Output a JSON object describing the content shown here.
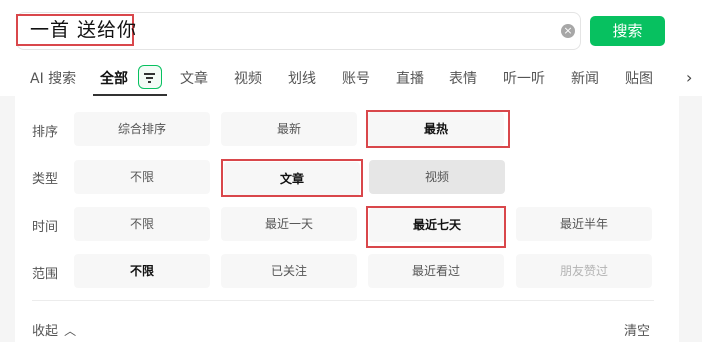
{
  "search": {
    "query": "一首 送给你",
    "clear_icon": "close-circle-icon",
    "button_label": "搜索",
    "button_color": "#07c160"
  },
  "tabs": [
    {
      "label": "AI 搜索"
    },
    {
      "label": "全部",
      "active": true
    },
    {
      "label": "文章"
    },
    {
      "label": "视频"
    },
    {
      "label": "划线"
    },
    {
      "label": "账号"
    },
    {
      "label": "直播"
    },
    {
      "label": "表情"
    },
    {
      "label": "听一听"
    },
    {
      "label": "新闻"
    },
    {
      "label": "贴图"
    }
  ],
  "filters": {
    "sort": {
      "label": "排序",
      "options": [
        "综合排序",
        "最新",
        "最热"
      ],
      "selected": "最热"
    },
    "type": {
      "label": "类型",
      "options": [
        "不限",
        "文章",
        "视频"
      ],
      "selected": "文章"
    },
    "time": {
      "label": "时间",
      "options": [
        "不限",
        "最近一天",
        "最近七天",
        "最近半年"
      ],
      "selected": "最近七天"
    },
    "scope": {
      "label": "范围",
      "options": [
        "不限",
        "已关注",
        "最近看过",
        "朋友赞过"
      ],
      "selected": "不限"
    }
  },
  "footer": {
    "collapse_label": "收起",
    "clear_label": "清空"
  },
  "highlight_color": "#d9474b"
}
